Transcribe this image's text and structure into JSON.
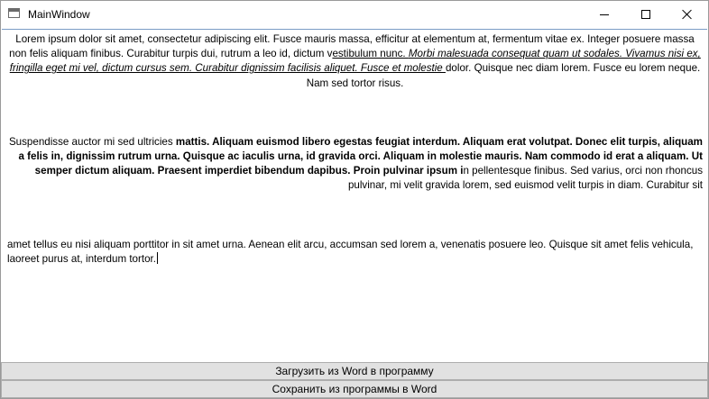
{
  "window": {
    "title": "MainWindow",
    "controls": {
      "minimize_icon": "minimize-icon",
      "maximize_icon": "maximize-icon",
      "close_icon": "close-icon"
    }
  },
  "document": {
    "p1": {
      "text_a": "Lorem ipsum dolor sit amet, consectetur adipiscing elit. Fusce mauris massa, efficitur at elementum at, fermentum vitae ex. Integer posuere massa non felis aliquam finibus. Curabitur turpis dui, rutrum a leo id, dictum v",
      "text_b": "estibulum nunc. ",
      "text_c": "Morbi malesuada consequat quam ut sodales. Vivamus nisi ex, fringilla eget mi vel, dictum cursus sem. Curabitur dignissim facilisis aliquet. Fusce et molestie ",
      "text_d": "dolor. Quisque nec diam lorem. Fusce eu lorem neque. Nam sed tortor risus."
    },
    "p2": {
      "text_a": "Suspendisse auctor mi sed ultricies ",
      "text_b": "mattis. Aliquam euismod libero egestas feugiat interdum. Aliquam erat volutpat. Donec elit turpis, aliquam a felis in, dignissim rutrum urna. Quisque ac iaculis urna, id gravida orci. Aliquam in molestie mauris. Nam commodo id erat a aliquam. Ut semper dictum aliquam. Praesent imperdiet bibendum dapibus. Proin pulvinar ipsum i",
      "text_c": "n pellentesque finibus. Sed varius, orci non rhoncus pulvinar, mi velit gravida lorem, sed euismod velit turpis in diam. Curabitur sit"
    },
    "p3": {
      "text": "amet tellus eu nisi aliquam porttitor in sit amet urna. Aenean elit arcu, accumsan sed lorem a, venenatis posuere leo. Quisque sit amet felis vehicula, laoreet purus at, interdum tortor."
    }
  },
  "buttons": {
    "load_label": "Загрузить из Word в программу",
    "save_label": "Сохранить из программы в Word"
  }
}
